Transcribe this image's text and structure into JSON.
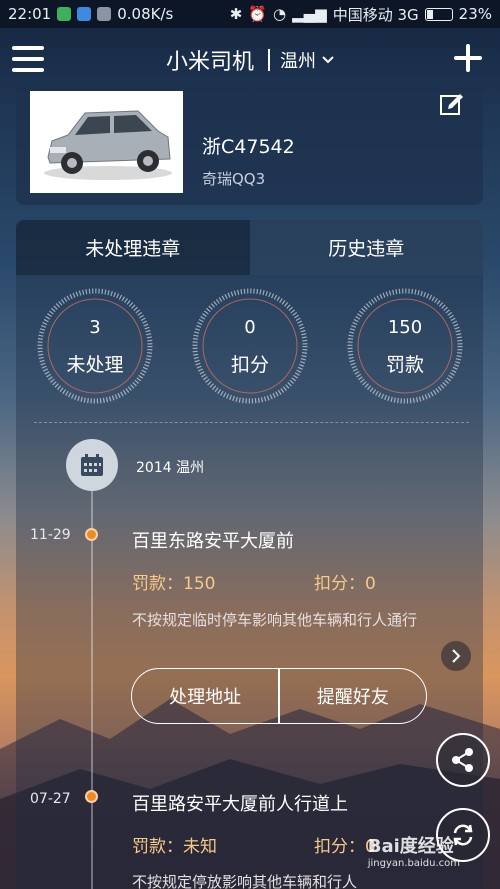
{
  "status_bar": {
    "time": "22:01",
    "speed": "0.08K/s",
    "carrier": "中国移动 3G",
    "battery": "23%"
  },
  "header": {
    "title": "小米司机",
    "city": "温州"
  },
  "car": {
    "plate": "浙C47542",
    "model": "奇瑞QQ3"
  },
  "tabs": [
    {
      "label": "未处理违章",
      "active": true
    },
    {
      "label": "历史违章",
      "active": false
    }
  ],
  "stats": [
    {
      "value": "3",
      "label": "未处理"
    },
    {
      "value": "0",
      "label": "扣分"
    },
    {
      "value": "150",
      "label": "罚款"
    }
  ],
  "timeline": {
    "year_city": "2014  温州",
    "violations": [
      {
        "date": "11-29",
        "location": "百里东路安平大厦前",
        "fine": "罚款：150",
        "points": "扣分：0",
        "description": "不按规定临时停车影响其他车辆和行人通行"
      },
      {
        "date": "07-27",
        "location": "百里路安平大厦前人行道上",
        "fine": "罚款：未知",
        "points": "扣分：0",
        "description": "不按规定停放影响其他车辆和行人"
      }
    ],
    "actions": {
      "address": "处理地址",
      "remind": "提醒好友"
    }
  },
  "watermark": {
    "brand": "Bai度经验",
    "url": "jingyan.baidu.com"
  },
  "colors": {
    "accent_dot": "#f08a24",
    "fine_text": "#f7c98a"
  }
}
